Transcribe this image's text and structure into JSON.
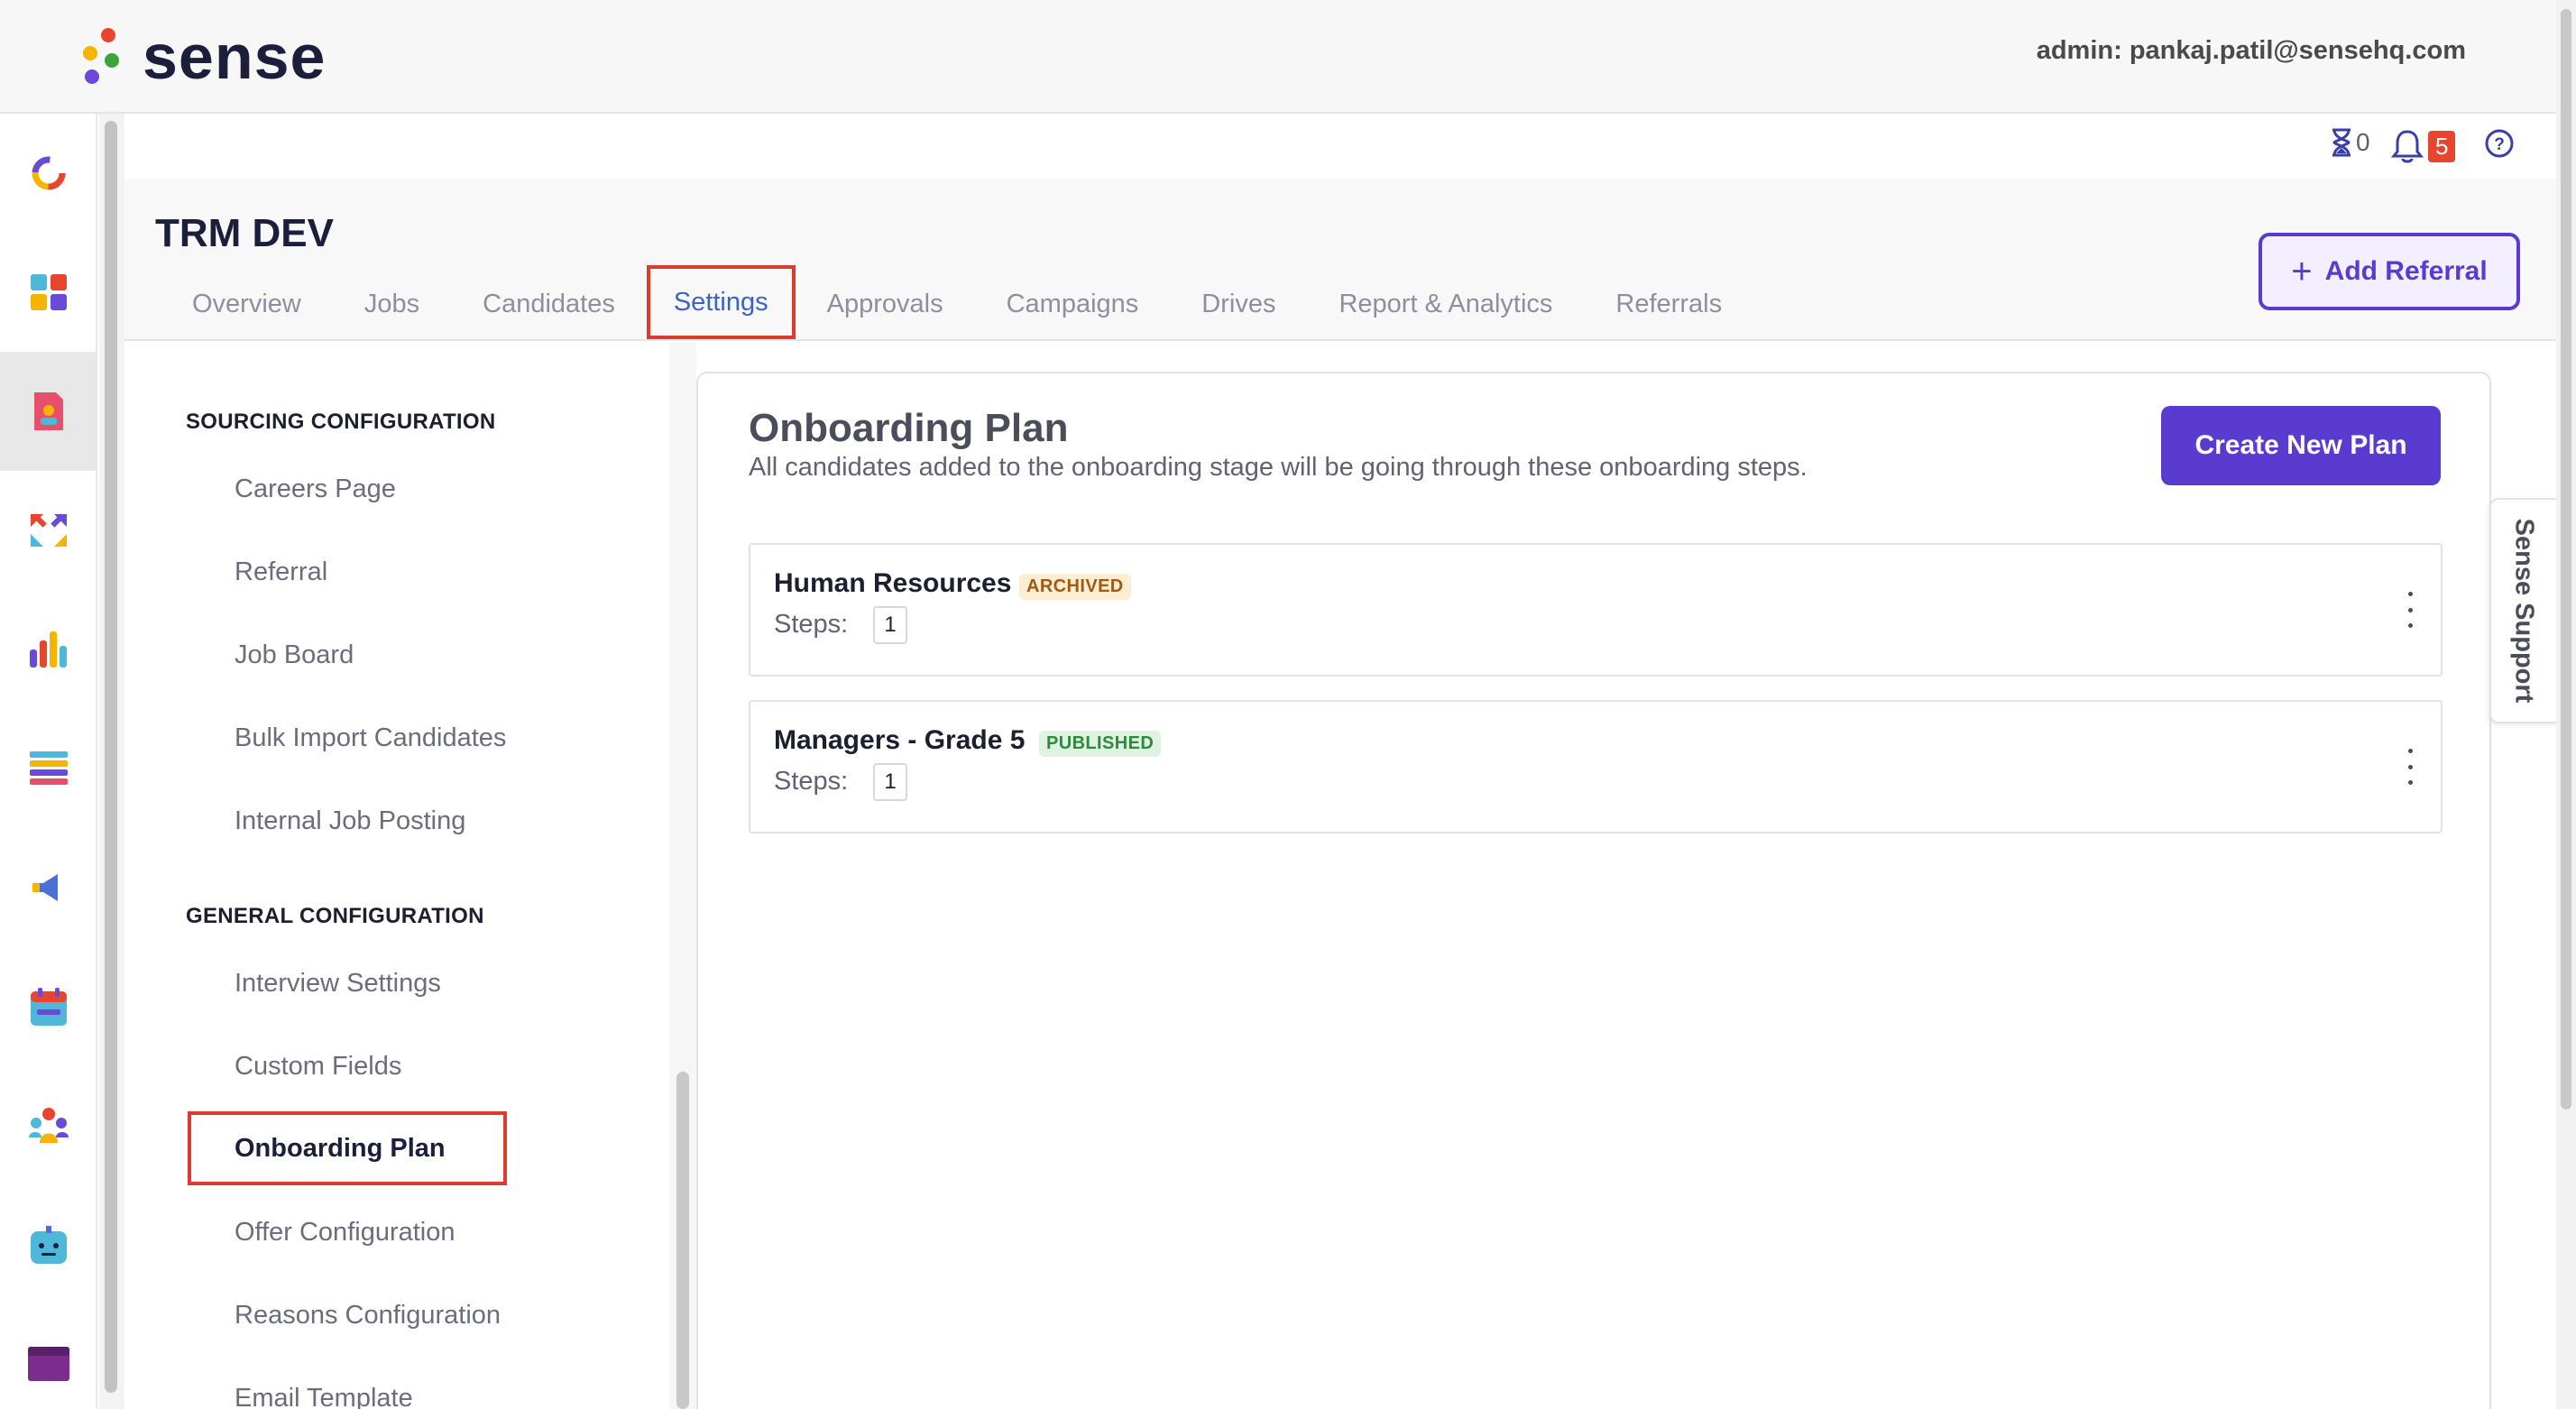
{
  "brand": {
    "logo_text": "sense",
    "dot_colors": [
      "#e8452f",
      "#f5b400",
      "#3aa53a",
      "#6a4ad6"
    ]
  },
  "header": {
    "admin_label": "admin: pankaj.patil@sensehq.com"
  },
  "rail": {
    "items": [
      {
        "icon": "ring-icon"
      },
      {
        "icon": "grid-icon"
      },
      {
        "icon": "document-icon",
        "active": true
      },
      {
        "icon": "arrows-icon"
      },
      {
        "icon": "bar-chart-icon"
      },
      {
        "icon": "list-icon"
      },
      {
        "icon": "megaphone-icon"
      },
      {
        "icon": "calendar-icon"
      },
      {
        "icon": "people-icon"
      },
      {
        "icon": "bot-icon"
      },
      {
        "icon": "window-icon"
      }
    ]
  },
  "toolbar": {
    "hourglass_count": "0",
    "notifications_count": "5"
  },
  "page": {
    "title": "TRM DEV",
    "tabs": [
      {
        "label": "Overview"
      },
      {
        "label": "Jobs"
      },
      {
        "label": "Candidates"
      },
      {
        "label": "Settings",
        "active": true
      },
      {
        "label": "Approvals"
      },
      {
        "label": "Campaigns"
      },
      {
        "label": "Drives"
      },
      {
        "label": "Report & Analytics"
      },
      {
        "label": "Referrals"
      }
    ],
    "add_referral_label": "Add Referral"
  },
  "settings_nav": {
    "sourcing_heading": "SOURCING CONFIGURATION",
    "sourcing_items": [
      "Careers Page",
      "Referral",
      "Job Board",
      "Bulk Import Candidates",
      "Internal Job Posting"
    ],
    "general_heading": "GENERAL CONFIGURATION",
    "general_items": [
      "Interview Settings",
      "Custom Fields",
      "Onboarding Plan",
      "Offer Configuration",
      "Reasons Configuration",
      "Email Template"
    ],
    "active_item": "Onboarding Plan"
  },
  "main": {
    "title": "Onboarding Plan",
    "description": "All candidates added to the onboarding stage will be going through these onboarding steps.",
    "create_button_label": "Create New Plan",
    "plans": [
      {
        "name": "Human Resources",
        "status": "ARCHIVED",
        "steps_label": "Steps:",
        "steps": "1"
      },
      {
        "name": "Managers - Grade 5",
        "status": "PUBLISHED",
        "steps_label": "Steps:",
        "steps": "1"
      }
    ],
    "status_colors": {
      "ARCHIVED": {
        "bg": "#fdeed3",
        "fg": "#a05a12"
      },
      "PUBLISHED": {
        "bg": "#dff3e2",
        "fg": "#2e8a3c"
      }
    }
  },
  "support": {
    "label": "Sense Support"
  }
}
